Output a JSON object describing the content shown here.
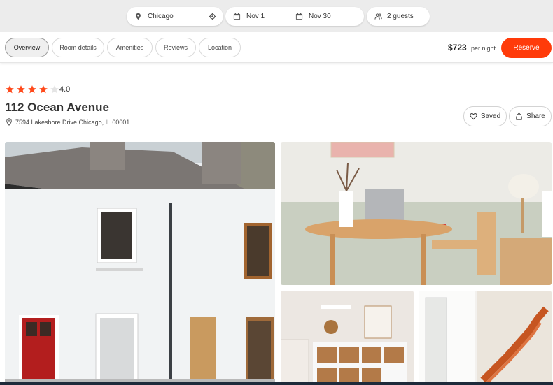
{
  "search": {
    "location": "Chicago",
    "check_in": "Nov 1",
    "check_out": "Nov 30",
    "guests": "2 guests"
  },
  "tabs": [
    {
      "label": "Overview",
      "active": true
    },
    {
      "label": "Room details",
      "active": false
    },
    {
      "label": "Amenities",
      "active": false
    },
    {
      "label": "Reviews",
      "active": false
    },
    {
      "label": "Location",
      "active": false
    }
  ],
  "pricing": {
    "price": "$723",
    "unit": "per night",
    "reserve_label": "Reserve"
  },
  "listing": {
    "rating": "4.0",
    "stars_filled": 4,
    "stars_total": 5,
    "title": "112 Ocean Avenue",
    "address": "7594 Lakeshore Drive Chicago, IL 60601",
    "saved_label": "Saved",
    "share_label": "Share"
  },
  "gallery": [
    {
      "subject": "white cottage exterior with red door"
    },
    {
      "subject": "dining table with laptop and lamp"
    },
    {
      "subject": "shelf with wicker baskets and globe"
    },
    {
      "subject": "orange staircase by window"
    }
  ],
  "colors": {
    "accent": "#ff3b0a",
    "star": "#ff4a1c",
    "star_empty": "#e4e4e4"
  },
  "icons": [
    "location-pin-icon",
    "locate-icon",
    "calendar-icon",
    "guests-icon",
    "star-icon",
    "heart-icon",
    "share-icon"
  ]
}
